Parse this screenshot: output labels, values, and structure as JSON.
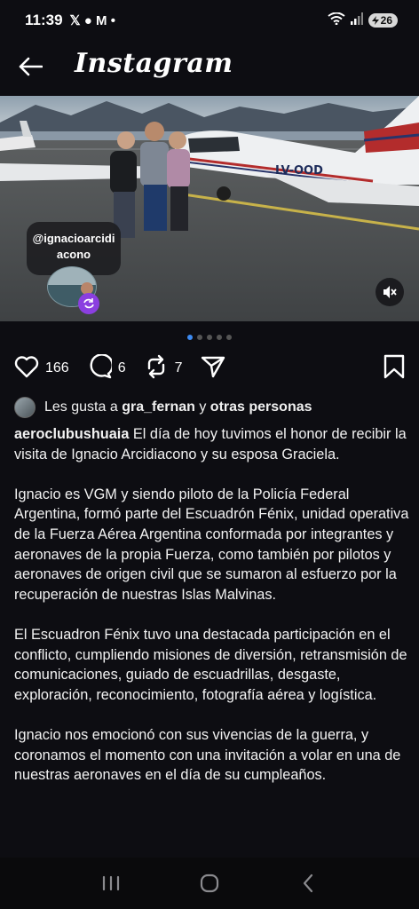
{
  "status_bar": {
    "time": "11:39",
    "notif_icons": "𝕏 ● M •",
    "battery": "26",
    "icons": [
      "x-icon",
      "facebook-messenger-icon",
      "gmail-icon",
      "dot-icon",
      "wifi-icon",
      "signal-icon",
      "battery-icon"
    ]
  },
  "header": {
    "brand": "Instagram",
    "icons": [
      "back-arrow-icon"
    ]
  },
  "photo": {
    "tag_handle": "@ignacioarcidiacono",
    "tag_line1": "@ignacioarcidi",
    "tag_line2": "acono",
    "plane_registration": "LV-OOD",
    "icons": [
      "mute-icon",
      "refresh-badge-icon"
    ]
  },
  "carousel": {
    "count": 5,
    "active": 0
  },
  "actions": {
    "likes_count": "166",
    "comments_count": "6",
    "reposts_count": "7",
    "icons": [
      "heart-icon",
      "comment-icon",
      "repost-icon",
      "share-icon",
      "bookmark-icon"
    ]
  },
  "likes": {
    "prefix": "Les gusta a",
    "user": "gra_fernan",
    "connector": "y",
    "others": "otras personas"
  },
  "caption": {
    "username": "aeroclubushuaia",
    "p1": "El día de hoy tuvimos el honor de recibir la visita de Ignacio Arcidiacono y su esposa Graciela.",
    "p2": "Ignacio es VGM y siendo piloto de la Policía Federal Argentina, formó parte del Escuadrón Fénix, unidad operativa de la Fuerza Aérea Argentina conformada por integrantes y aeronaves de la propia Fuerza, como también por pilotos y aeronaves de origen civil que se sumaron al esfuerzo por la recuperación de nuestras Islas Malvinas.",
    "p3": "El Escuadron Fénix tuvo una destacada participación en el conflicto, cumpliendo misiones de diversión, retransmisión de comunicaciones, guiado de escuadrillas, desgaste, exploración, reconocimiento, fotografía aérea y logística.",
    "p4": "Ignacio nos emocionó con sus vivencias de la guerra, y coronamos el momento con una invitación a volar en una de nuestras aeronaves en el día de su cumpleaños."
  },
  "nav": {
    "icons": [
      "recent-apps-icon",
      "home-icon",
      "back-icon"
    ]
  },
  "colors": {
    "background": "#0d0d12",
    "accent_dot": "#3d8bf2",
    "badge_purple": "#8b3fe0"
  }
}
